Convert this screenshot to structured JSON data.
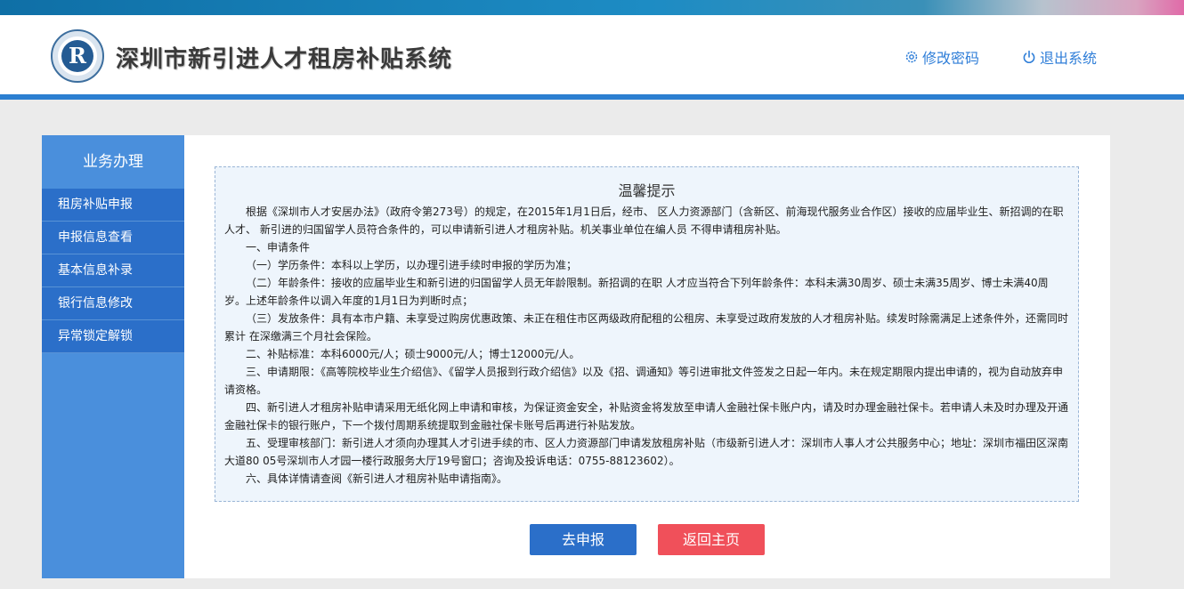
{
  "header": {
    "title": "深圳市新引进人才租房补贴系统",
    "change_password": "修改密码",
    "logout": "退出系统",
    "logo_letter": "R"
  },
  "sidebar": {
    "title": "业务办理",
    "items": [
      {
        "label": "租房补贴申报"
      },
      {
        "label": "申报信息查看"
      },
      {
        "label": "基本信息补录"
      },
      {
        "label": "银行信息修改"
      },
      {
        "label": "异常锁定解锁"
      }
    ]
  },
  "notice": {
    "title": "温馨提示",
    "paragraphs": [
      "根据《深圳市人才安居办法》（政府令第273号）的规定，在2015年1月1日后，经市、 区人力资源部门（含新区、前海现代服务业合作区）接收的应届毕业生、新招调的在职人才、 新引进的归国留学人员符合条件的，可以申请新引进人才租房补贴。机关事业单位在编人员 不得申请租房补贴。",
      "一、申请条件",
      "（一）学历条件：本科以上学历，以办理引进手续时申报的学历为准；",
      "（二）年龄条件：接收的应届毕业生和新引进的归国留学人员无年龄限制。新招调的在职 人才应当符合下列年龄条件：本科未满30周岁、硕士未满35周岁、博士未满40周岁。上述年龄条件以调入年度的1月1日为判断时点；",
      "（三）发放条件：具有本市户籍、未享受过购房优惠政策、未正在租住市区两级政府配租的公租房、未享受过政府发放的人才租房补贴。续发时除需满足上述条件外，还需同时累计 在深缴满三个月社会保险。",
      "二、补贴标准：本科6000元/人；硕士9000元/人；博士12000元/人。",
      "三、申请期限：《高等院校毕业生介绍信》、《留学人员报到行政介绍信》以及《招、调通知》等引进审批文件签发之日起一年内。未在规定期限内提出申请的，视为自动放弃申请资格。",
      "四、新引进人才租房补贴申请采用无纸化网上申请和审核，为保证资金安全，补贴资金将发放至申请人金融社保卡账户内，请及时办理金融社保卡。若申请人未及时办理及开通金融社保卡的银行账户，下一个拨付周期系统提取到金融社保卡账号后再进行补贴发放。",
      "五、受理审核部门：新引进人才须向办理其人才引进手续的市、区人力资源部门申请发放租房补贴（市级新引进人才：深圳市人事人才公共服务中心；地址：深圳市福田区深南大道80 05号深圳市人才园一楼行政服务大厅19号窗口；咨询及投诉电话：0755-88123602）。",
      "六、具体详情请查阅《新引进人才租房补贴申请指南》。"
    ]
  },
  "buttons": {
    "apply": "去申报",
    "home": "返回主页"
  },
  "colors": {
    "primary": "#2b6fc9",
    "sidebar": "#4a8fdc",
    "danger": "#f0505a",
    "link": "#2f7ed8"
  }
}
